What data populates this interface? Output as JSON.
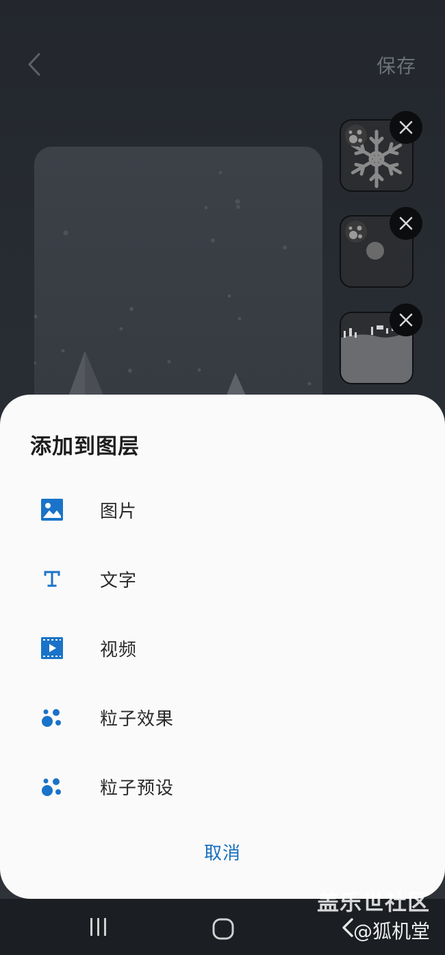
{
  "header": {
    "save_label": "保存"
  },
  "sheet": {
    "title": "添加到图层",
    "items": [
      {
        "label": "图片",
        "icon": "image-icon"
      },
      {
        "label": "文字",
        "icon": "text-icon"
      },
      {
        "label": "视频",
        "icon": "video-icon"
      },
      {
        "label": "粒子效果",
        "icon": "particle-effect-icon"
      },
      {
        "label": "粒子预设",
        "icon": "particle-preset-icon"
      }
    ],
    "cancel_label": "取消"
  },
  "layers": [
    {
      "icon": "snowflake-icon"
    },
    {
      "icon": "circle-particle-icon"
    },
    {
      "icon": "winter-landscape-icon"
    }
  ],
  "watermark": {
    "line1": "盖乐世社区",
    "line2": "@狐机堂"
  },
  "colors": {
    "accent": "#1a73c8",
    "sheet_bg": "#fafafa",
    "editor_bg": "#262a30"
  }
}
